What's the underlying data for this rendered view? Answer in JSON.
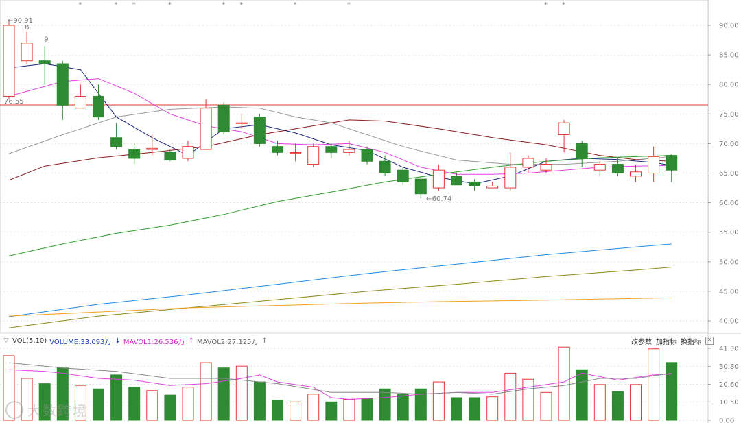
{
  "price_axis": {
    "ticks": [
      "90.00",
      "85.00",
      "80.00",
      "75.00",
      "70.00",
      "65.00",
      "60.00",
      "55.00",
      "50.00",
      "45.00",
      "40.00"
    ],
    "tick_values": [
      90,
      85,
      80,
      75,
      70,
      65,
      60,
      55,
      50,
      45,
      40
    ]
  },
  "volume_axis": {
    "ticks": [
      "41.30",
      "30.80",
      "20.60",
      "10.50",
      "0.00"
    ],
    "tick_values": [
      41.3,
      30.8,
      20.6,
      10.5,
      0
    ]
  },
  "labels": {
    "high": "←90.91",
    "low": "←60.74",
    "ref_price": "76.55",
    "count8": "8",
    "count9": "9"
  },
  "volume_header": {
    "indicator": "VOL(5,10)",
    "volume": "VOLUME:33.093万",
    "volume_arrow": "↓",
    "mavol1": "MAVOL1:26.536万",
    "mavol1_arrow": "↑",
    "mavol2": "MAVOL2:27.125万",
    "mavol2_arrow": "↑"
  },
  "toolbar": {
    "change_params": "改参数",
    "add_indicator": "加指标",
    "switch_indicator": "换指标",
    "close": "×"
  },
  "watermark": "大数跨境",
  "colors": {
    "up": "#e53935",
    "down": "#2e8b32",
    "ma5": "#1a237e",
    "ma10": "#e040e0",
    "ma20": "#999999",
    "ma30": "#8b1a1a",
    "ma60": "#2e9e2e",
    "ma120": "#1e88e5",
    "ma250": "#8a8a1a",
    "ma500": "#f0a020",
    "ref_line": "#e53935",
    "grid": "#d9d9d9"
  },
  "chart_data": {
    "type": "candlestick",
    "ref_line": 76.55,
    "candles": [
      {
        "o": 78.0,
        "h": 90.91,
        "l": 77.5,
        "c": 90.0,
        "v": 37.0
      },
      {
        "o": 84.0,
        "h": 89.0,
        "l": 83.5,
        "c": 87.0,
        "v": 24.0
      },
      {
        "o": 84.0,
        "h": 86.5,
        "l": 80.0,
        "c": 83.5,
        "v": 21.0
      },
      {
        "o": 83.5,
        "h": 84.0,
        "l": 74.0,
        "c": 76.5,
        "v": 30.0
      },
      {
        "o": 76.0,
        "h": 80.0,
        "l": 76.0,
        "c": 78.0,
        "v": 20.0
      },
      {
        "o": 78.0,
        "h": 80.0,
        "l": 74.0,
        "c": 74.5,
        "v": 18.0
      },
      {
        "o": 71.0,
        "h": 73.5,
        "l": 69.0,
        "c": 69.5,
        "v": 26.0
      },
      {
        "o": 69.0,
        "h": 70.0,
        "l": 66.5,
        "c": 67.5,
        "v": 19.0
      },
      {
        "o": 69.0,
        "h": 71.5,
        "l": 68.0,
        "c": 69.2,
        "v": 17.0
      },
      {
        "o": 68.5,
        "h": 69.0,
        "l": 67.0,
        "c": 67.2,
        "v": 14.5
      },
      {
        "o": 67.5,
        "h": 70.5,
        "l": 67.0,
        "c": 69.5,
        "v": 19.0
      },
      {
        "o": 69.0,
        "h": 77.5,
        "l": 69.0,
        "c": 76.0,
        "v": 33.0
      },
      {
        "o": 76.5,
        "h": 77.0,
        "l": 71.5,
        "c": 72.0,
        "v": 30.0
      },
      {
        "o": 73.5,
        "h": 75.0,
        "l": 72.5,
        "c": 73.5,
        "v": 31.0
      },
      {
        "o": 74.5,
        "h": 75.0,
        "l": 69.5,
        "c": 70.0,
        "v": 22.0
      },
      {
        "o": 69.5,
        "h": 70.5,
        "l": 68.0,
        "c": 68.5,
        "v": 11.5
      },
      {
        "o": 68.5,
        "h": 70.0,
        "l": 67.0,
        "c": 68.5,
        "v": 10.5
      },
      {
        "o": 66.5,
        "h": 70.0,
        "l": 66.0,
        "c": 69.5,
        "v": 15.0
      },
      {
        "o": 69.5,
        "h": 70.0,
        "l": 67.5,
        "c": 68.5,
        "v": 10.5
      },
      {
        "o": 68.5,
        "h": 70.5,
        "l": 68.0,
        "c": 69.0,
        "v": 12.0
      },
      {
        "o": 69.0,
        "h": 69.5,
        "l": 66.5,
        "c": 67.0,
        "v": 12.5
      },
      {
        "o": 67.0,
        "h": 68.0,
        "l": 64.5,
        "c": 65.0,
        "v": 18.0
      },
      {
        "o": 65.5,
        "h": 66.0,
        "l": 63.0,
        "c": 63.5,
        "v": 15.0
      },
      {
        "o": 64.0,
        "h": 64.5,
        "l": 60.74,
        "c": 61.5,
        "v": 18.0
      },
      {
        "o": 62.5,
        "h": 66.5,
        "l": 62.0,
        "c": 65.5,
        "v": 22.0
      },
      {
        "o": 64.5,
        "h": 65.0,
        "l": 63.0,
        "c": 63.0,
        "v": 13.0
      },
      {
        "o": 63.5,
        "h": 64.0,
        "l": 62.0,
        "c": 62.8,
        "v": 13.0
      },
      {
        "o": 62.5,
        "h": 63.5,
        "l": 62.5,
        "c": 62.8,
        "v": 13.5
      },
      {
        "o": 62.5,
        "h": 68.5,
        "l": 62.0,
        "c": 66.0,
        "v": 27.0
      },
      {
        "o": 66.0,
        "h": 68.0,
        "l": 65.0,
        "c": 67.5,
        "v": 23.5
      },
      {
        "o": 65.5,
        "h": 67.5,
        "l": 65.0,
        "c": 66.5,
        "v": 16.0
      },
      {
        "o": 71.5,
        "h": 74.0,
        "l": 68.5,
        "c": 73.5,
        "v": 42.0
      },
      {
        "o": 70.0,
        "h": 70.5,
        "l": 66.0,
        "c": 67.5,
        "v": 29.0
      },
      {
        "o": 65.5,
        "h": 67.0,
        "l": 64.5,
        "c": 66.5,
        "v": 20.5
      },
      {
        "o": 66.5,
        "h": 67.5,
        "l": 64.5,
        "c": 65.0,
        "v": 16.5
      },
      {
        "o": 64.5,
        "h": 66.5,
        "l": 63.5,
        "c": 65.2,
        "v": 20.5
      },
      {
        "o": 65.0,
        "h": 69.5,
        "l": 63.5,
        "c": 67.8,
        "v": 41.0
      },
      {
        "o": 68.0,
        "h": 68.2,
        "l": 63.5,
        "c": 65.5,
        "v": 33.1
      }
    ],
    "markers": [
      false,
      false,
      false,
      false,
      true,
      false,
      true,
      true,
      false,
      true,
      false,
      false,
      true,
      true,
      false,
      false,
      true,
      false,
      false,
      true,
      false,
      false,
      false,
      false,
      false,
      false,
      false,
      false,
      false,
      false,
      true,
      true,
      false,
      false,
      false,
      false,
      false,
      false
    ],
    "ma": [
      {
        "name": "ma5",
        "pts": [
          [
            0,
            82.8
          ],
          [
            2,
            83.5
          ],
          [
            4,
            82.5
          ],
          [
            6,
            74.5
          ],
          [
            8,
            71.0
          ],
          [
            10,
            68.0
          ],
          [
            12,
            72.5
          ],
          [
            14,
            73.2
          ],
          [
            16,
            71.8
          ],
          [
            18,
            69.8
          ],
          [
            20,
            68.8
          ],
          [
            22,
            66.0
          ],
          [
            24,
            64.3
          ],
          [
            26,
            63.2
          ],
          [
            28,
            64.5
          ],
          [
            30,
            67.0
          ],
          [
            32,
            67.5
          ],
          [
            34,
            67.3
          ],
          [
            36,
            66.8
          ],
          [
            37,
            66.3
          ]
        ]
      },
      {
        "name": "ma10",
        "pts": [
          [
            0,
            78.0
          ],
          [
            3,
            80.5
          ],
          [
            5,
            81.0
          ],
          [
            7,
            78.5
          ],
          [
            9,
            75.0
          ],
          [
            11,
            73.0
          ],
          [
            13,
            72.0
          ],
          [
            15,
            70.0
          ],
          [
            17,
            69.8
          ],
          [
            19,
            70.0
          ],
          [
            21,
            68.5
          ],
          [
            23,
            66.0
          ],
          [
            25,
            64.8
          ],
          [
            27,
            64.8
          ],
          [
            29,
            65.0
          ],
          [
            31,
            65.5
          ],
          [
            33,
            66.0
          ],
          [
            35,
            66.2
          ],
          [
            37,
            66.3
          ]
        ]
      },
      {
        "name": "ma20",
        "pts": [
          [
            0,
            68.3
          ],
          [
            3,
            71.5
          ],
          [
            6,
            74.5
          ],
          [
            9,
            75.8
          ],
          [
            12,
            76.2
          ],
          [
            14,
            76.0
          ],
          [
            16,
            74.5
          ],
          [
            18,
            73.5
          ],
          [
            20,
            71.5
          ],
          [
            22,
            69.5
          ],
          [
            25,
            67.2
          ],
          [
            28,
            66.5
          ],
          [
            31,
            66.5
          ],
          [
            34,
            67.0
          ],
          [
            37,
            67.8
          ]
        ]
      },
      {
        "name": "ma30",
        "pts": [
          [
            0,
            63.8
          ],
          [
            2,
            66.2
          ],
          [
            5,
            67.6
          ],
          [
            8,
            68.5
          ],
          [
            11,
            69.5
          ],
          [
            14,
            71.5
          ],
          [
            17,
            73.0
          ],
          [
            19,
            74.0
          ],
          [
            21,
            73.8
          ],
          [
            24,
            72.5
          ],
          [
            27,
            71.0
          ],
          [
            30,
            69.8
          ],
          [
            33,
            68.0
          ],
          [
            35,
            67.3
          ],
          [
            37,
            67.0
          ]
        ]
      },
      {
        "name": "ma60",
        "pts": [
          [
            0,
            51.0
          ],
          [
            3,
            53.0
          ],
          [
            6,
            54.8
          ],
          [
            9,
            56.2
          ],
          [
            12,
            58.0
          ],
          [
            15,
            60.2
          ],
          [
            18,
            61.8
          ],
          [
            21,
            63.5
          ],
          [
            24,
            64.8
          ],
          [
            27,
            66.0
          ],
          [
            30,
            67.0
          ],
          [
            33,
            67.6
          ],
          [
            35,
            67.8
          ],
          [
            37,
            68.0
          ]
        ]
      },
      {
        "name": "ma120",
        "pts": [
          [
            0,
            40.7
          ],
          [
            5,
            42.8
          ],
          [
            10,
            44.4
          ],
          [
            15,
            46.2
          ],
          [
            20,
            48.0
          ],
          [
            25,
            49.6
          ],
          [
            30,
            51.2
          ],
          [
            35,
            52.5
          ],
          [
            37,
            53.0
          ]
        ]
      },
      {
        "name": "ma250",
        "pts": [
          [
            0,
            38.8
          ],
          [
            5,
            40.8
          ],
          [
            10,
            42.2
          ],
          [
            15,
            43.6
          ],
          [
            20,
            45.0
          ],
          [
            25,
            46.2
          ],
          [
            30,
            47.5
          ],
          [
            35,
            48.6
          ],
          [
            37,
            49.1
          ]
        ]
      },
      {
        "name": "ma500",
        "pts": [
          [
            0,
            40.8
          ],
          [
            5,
            41.5
          ],
          [
            10,
            42.2
          ],
          [
            15,
            42.6
          ],
          [
            20,
            43.0
          ],
          [
            25,
            43.3
          ],
          [
            30,
            43.5
          ],
          [
            35,
            43.8
          ],
          [
            37,
            43.9
          ]
        ]
      }
    ],
    "mavol1": [
      [
        0,
        29
      ],
      [
        2,
        28
      ],
      [
        3,
        27
      ],
      [
        5,
        24
      ],
      [
        7,
        23
      ],
      [
        9,
        20
      ],
      [
        11,
        21
      ],
      [
        13,
        24
      ],
      [
        14,
        26
      ],
      [
        15,
        22
      ],
      [
        17,
        19
      ],
      [
        18,
        13
      ],
      [
        19,
        12
      ],
      [
        21,
        13
      ],
      [
        23,
        15
      ],
      [
        25,
        16
      ],
      [
        27,
        16
      ],
      [
        29,
        19
      ],
      [
        31,
        22
      ],
      [
        32,
        27
      ],
      [
        34,
        23
      ],
      [
        36,
        26
      ],
      [
        37,
        26.5
      ]
    ],
    "mavol2": [
      [
        0,
        33
      ],
      [
        3,
        30
      ],
      [
        6,
        28
      ],
      [
        9,
        24
      ],
      [
        12,
        24
      ],
      [
        15,
        21
      ],
      [
        18,
        16
      ],
      [
        21,
        16
      ],
      [
        23,
        15
      ],
      [
        25,
        16
      ],
      [
        27,
        15
      ],
      [
        29,
        18
      ],
      [
        31,
        20
      ],
      [
        33,
        24
      ],
      [
        35,
        24
      ],
      [
        37,
        27
      ]
    ]
  }
}
